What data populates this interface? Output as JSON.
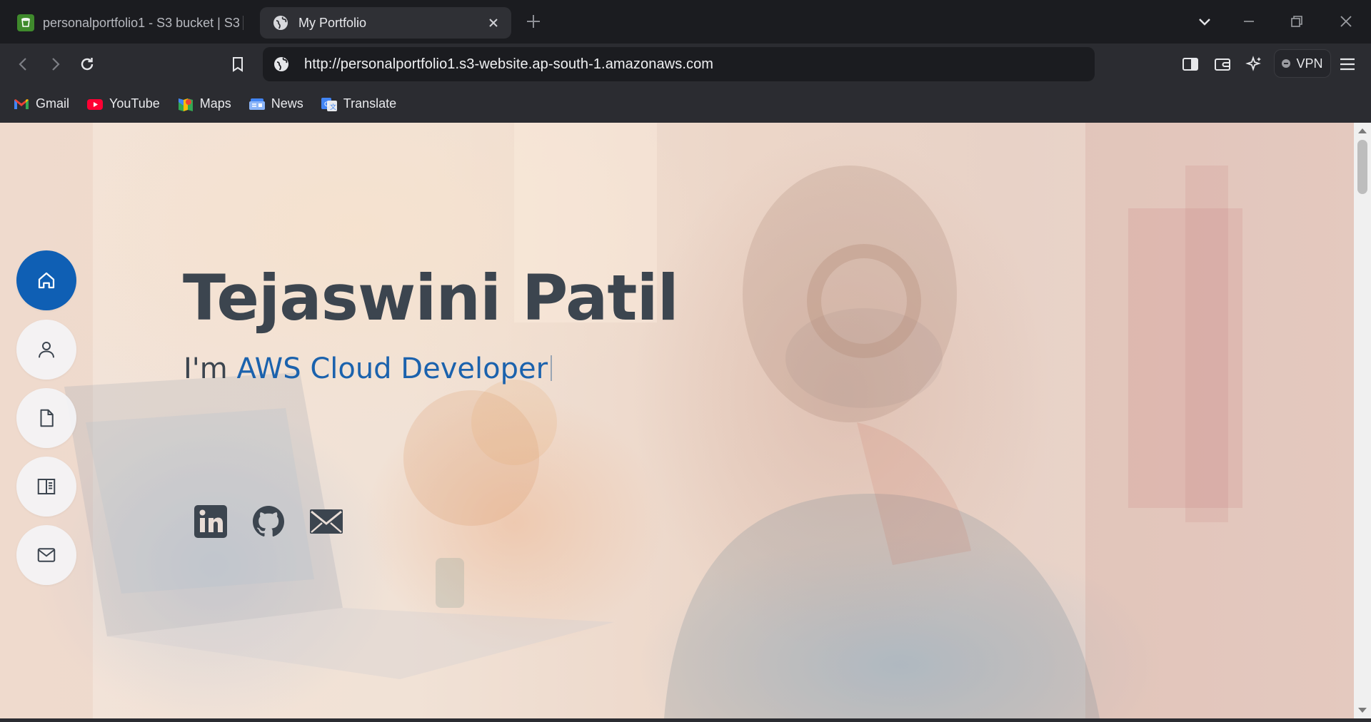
{
  "browser": {
    "tabs": [
      {
        "title": "personalportfolio1 - S3 bucket | S3",
        "favicon": "s3-bucket-icon",
        "active": false
      },
      {
        "title": "My Portfolio",
        "favicon": "globe-icon",
        "active": true
      }
    ],
    "url": "http://personalportfolio1.s3-website.ap-south-1.amazonaws.com",
    "vpn_label": "VPN",
    "bookmarks": [
      {
        "label": "Gmail",
        "icon": "gmail-icon"
      },
      {
        "label": "YouTube",
        "icon": "youtube-icon"
      },
      {
        "label": "Maps",
        "icon": "maps-icon"
      },
      {
        "label": "News",
        "icon": "news-icon"
      },
      {
        "label": "Translate",
        "icon": "translate-icon"
      }
    ]
  },
  "page": {
    "name": "Tejaswini Patil",
    "subtitle_prefix": "I'm",
    "role": "AWS Cloud Developer",
    "nav": [
      {
        "id": "home",
        "icon": "home-icon",
        "active": true
      },
      {
        "id": "about",
        "icon": "user-icon",
        "active": false
      },
      {
        "id": "resume",
        "icon": "file-icon",
        "active": false
      },
      {
        "id": "portfolio",
        "icon": "book-icon",
        "active": false
      },
      {
        "id": "contact",
        "icon": "mail-icon",
        "active": false
      }
    ],
    "social": [
      "linkedin-icon",
      "github-icon",
      "envelope-icon"
    ]
  },
  "colors": {
    "accent": "#0f5fb4",
    "role_text": "#1b62ad",
    "heading": "#3c454f"
  }
}
